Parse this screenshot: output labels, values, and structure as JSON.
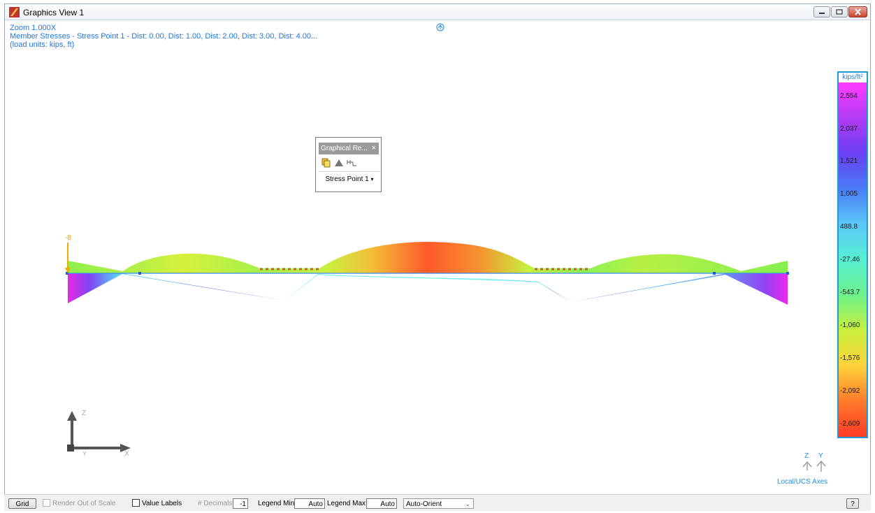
{
  "window": {
    "title": "Graphics View 1"
  },
  "info": {
    "zoom": "Zoom  1.000X",
    "result": "Member Stresses - Stress Point 1 - Dist: 0.00, Dist: 1.00, Dist: 2.00, Dist: 3.00, Dist: 4.00...",
    "units": " (load units: kips, ft)"
  },
  "diagram": {
    "load_label": "-8",
    "global_axes": {
      "z": "Z",
      "x": "X",
      "y": "Y"
    },
    "local_axes": {
      "z": "Z",
      "y": "Y",
      "caption": "Local/UCS Axes"
    }
  },
  "legend": {
    "unit": "kips/ft²",
    "labels": [
      "2,554",
      "2,037",
      "1,521",
      "1,005",
      "488.8",
      "-27.46",
      "-543.7",
      "-1,060",
      "-1,576",
      "-2,092",
      "-2,609"
    ]
  },
  "float_panel": {
    "title": "Graphical Re...",
    "close": "×",
    "dropdown_value": "Stress Point 1"
  },
  "toolbar": {
    "grid": "Grid",
    "render_out_of_scale": "Render Out of Scale",
    "value_labels": "Value Labels",
    "decimals_label": "# Decimals:",
    "decimals_value": "-1",
    "legend_min_label": "Legend Min",
    "legend_min_value": "Auto",
    "legend_max_label": "Legend Max",
    "legend_max_value": "Auto",
    "orient": "Auto-Orient",
    "help": "?"
  },
  "colors": {
    "info_text": "#1d76e8",
    "legend_border": "#1f9bd8"
  }
}
